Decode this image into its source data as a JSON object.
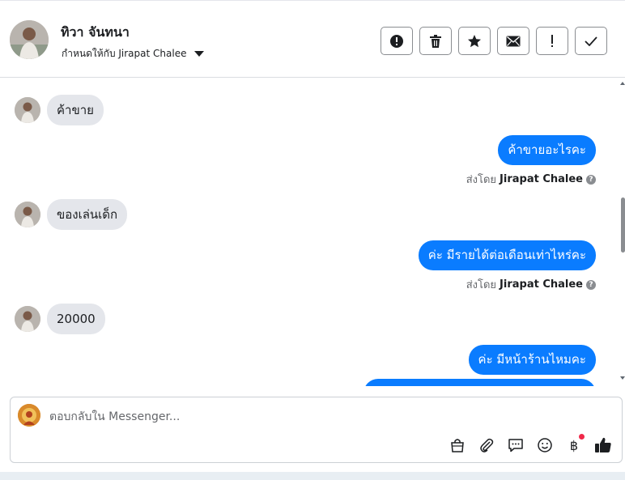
{
  "header": {
    "contact_name": "ทิวา จันทนา",
    "assign_label": "กำหนดให้กับ Jirapat Chalee",
    "actions": [
      {
        "name": "spam-report-button",
        "icon": "alert-circle-icon"
      },
      {
        "name": "delete-button",
        "icon": "trash-icon"
      },
      {
        "name": "star-button",
        "icon": "star-icon"
      },
      {
        "name": "mark-unread-button",
        "icon": "envelope-icon"
      },
      {
        "name": "follow-up-button",
        "icon": "exclamation-icon"
      },
      {
        "name": "mark-done-button",
        "icon": "check-icon"
      }
    ]
  },
  "thread": {
    "partial_top": "่",
    "messages": [
      {
        "direction": "in",
        "text": "ค้าขาย"
      },
      {
        "direction": "out",
        "text": "ค้าขายอะไรคะ",
        "sent_by_label": "ส่งโดย",
        "sent_by_name": "Jirapat Chalee"
      },
      {
        "direction": "in",
        "text": "ของเล่นเด็ก"
      },
      {
        "direction": "out",
        "text": "ค่ะ มีรายได้ต่อเดือนเท่าไหร่คะ",
        "sent_by_label": "ส่งโดย",
        "sent_by_name": "Jirapat Chalee"
      },
      {
        "direction": "in",
        "text": "20000"
      },
      {
        "direction": "out",
        "text": "ค่ะ มีหน้าร้านไหมคะ"
      }
    ],
    "help_glyph": "?"
  },
  "composer": {
    "placeholder": "ตอบกลับใน Messenger...",
    "tools": [
      "bag-icon",
      "paperclip-icon",
      "saved-reply-icon",
      "emoji-icon",
      "baht-payment-icon",
      "like-icon"
    ],
    "baht_glyph": "฿"
  },
  "colors": {
    "outgoing_bubble": "#0a7cff",
    "incoming_bubble": "#e4e6eb",
    "notification_dot": "#f02849"
  }
}
